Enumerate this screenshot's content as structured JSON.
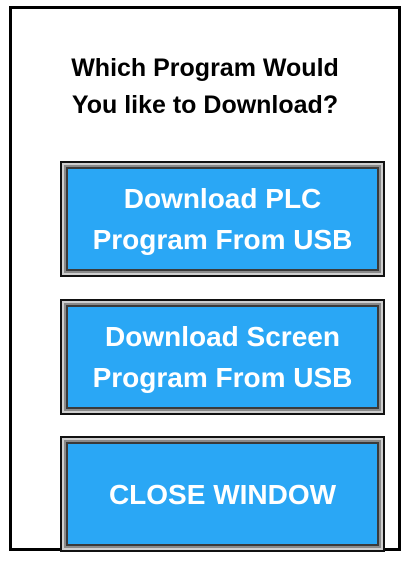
{
  "dialog": {
    "prompt": "Which Program Would\nYou like to Download?",
    "buttons": {
      "download_plc": "Download PLC\nProgram From USB",
      "download_screen": "Download Screen\nProgram From USB",
      "close_window": "CLOSE WINDOW"
    }
  },
  "colors": {
    "button_fill": "#2aa7f5",
    "button_text": "#ffffff",
    "frame_border": "#000000",
    "background": "#ffffff"
  }
}
